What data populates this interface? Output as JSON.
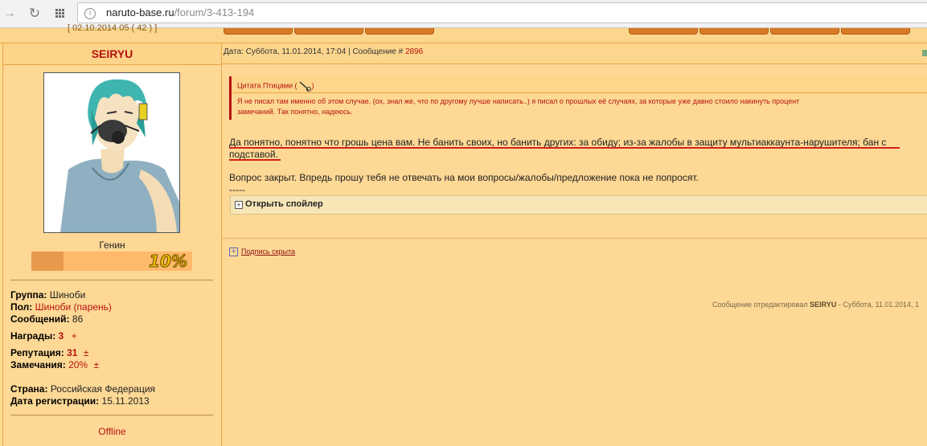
{
  "browser": {
    "url_domain": "naruto-base.ru",
    "url_path": "/forum/3-413-194"
  },
  "top_strip": {
    "date_fragment": "[ 02.10.2014 05 ( 42 ) ]"
  },
  "profile": {
    "username": "SEIRYU",
    "rank": "Генин",
    "rank_percent_label": "10%",
    "rank_fill": 0.2,
    "group_label": "Группа:",
    "group_value": "Шиноби",
    "gender_label": "Пол:",
    "gender_value": "Шиноби (парень)",
    "posts_label": "Сообщений:",
    "posts_value": "86",
    "awards_label": "Награды:",
    "awards_value": "3",
    "awards_action": "+",
    "reputation_label": "Репутация:",
    "reputation_value": "31",
    "reputation_action": "±",
    "warnings_label": "Замечания:",
    "warnings_value": "20%",
    "warnings_action": "±",
    "country_label": "Страна:",
    "country_value": "Российская Федерация",
    "regdate_label": "Дата регистрации:",
    "regdate_value": "15.11.2013",
    "status": "Offline"
  },
  "post": {
    "header_prefix": "Дата: Суббота, 11.01.2014, 17:04 | Сообщение #",
    "message_number": "2896",
    "quote_title": "Цитата Птицами (",
    "quote_title_end": ")",
    "quote_line1": "Я не писал там именно об этом случае. (ох, знал же, что по другому лучше написать..) я писал о прошлых её случаях, за которые уже давно стоило накинуть процент",
    "quote_line2": "замечаний. Так понятно, надеюсь.",
    "reply_line1": "Да понятно, понятно что грошь цена вам. Не банить своих, но банить других: за обиду; из-за жалобы в защиту мультиаккаунта-нарушителя; бан с",
    "reply_line2": "подставой.",
    "reply_line3": "Вопрос закрыт. Впредь прошу тебя не отвечать на мои вопросы/жалобы/предложение пока не попросят.",
    "separator": "-----",
    "spoiler_label": "Открыть спойлер",
    "signature_label": "Подпись скрыта",
    "edited_prefix": "Сообщение отредактировал",
    "edited_user": "SEIRYU",
    "edited_suffix": "- Суббота, 11.01.2014, 1"
  },
  "colors": {
    "page_bg": "#fdda90",
    "accent_red": "#b5140f",
    "border_orange": "#e8a646"
  }
}
